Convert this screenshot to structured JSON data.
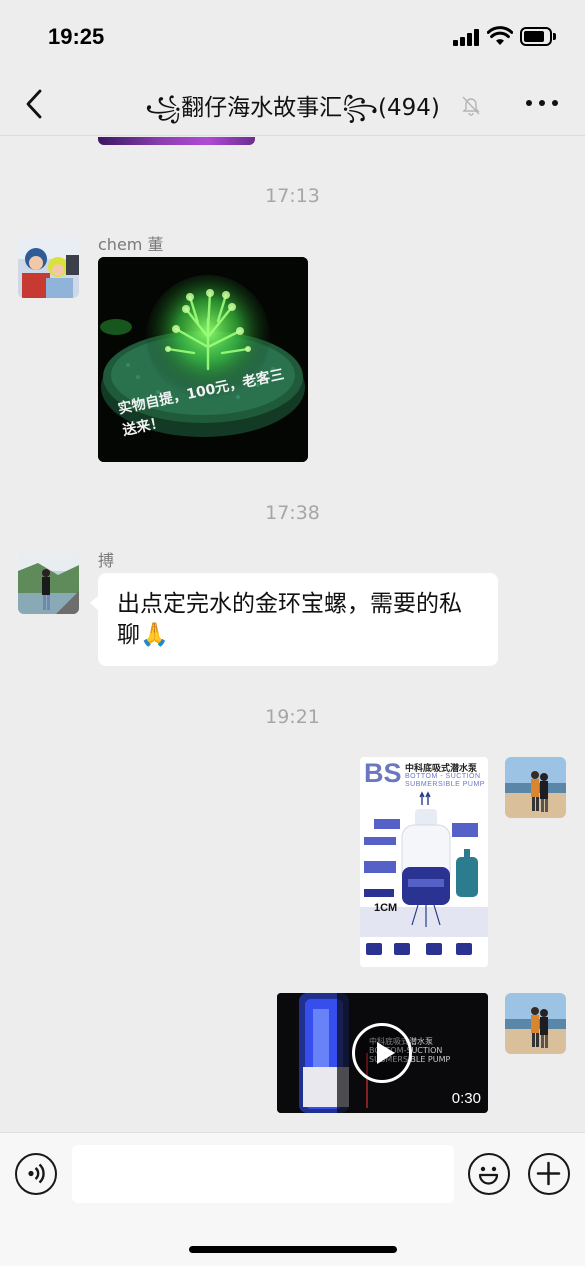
{
  "status_bar": {
    "time": "19:25"
  },
  "header": {
    "title": "🌬️翻仔海水故事汇🌬️(494)",
    "title_parts": {
      "deco_left": "꧁",
      "name": "翻仔海水故事汇",
      "deco_right": "꧂",
      "count": "(494)"
    },
    "icons": {
      "back": "chevron-left-icon",
      "mute": "bell-slash-icon",
      "more": "ellipsis-icon"
    }
  },
  "messages": {
    "time_1": "17:13",
    "msg_1": {
      "sender": "chem 董",
      "type": "image",
      "caption": "实物自提，100元，老客三送来！"
    },
    "time_2": "17:38",
    "msg_2": {
      "sender": "搏",
      "type": "text",
      "text": "出点定完水的金环宝螺，需要的私聊🙏"
    },
    "time_3": "19:21",
    "msg_3": {
      "type": "image",
      "poster": {
        "brand": "BS",
        "cn_title": "中科底吸式潜水泵",
        "en_title_1": "BOTTOM - SUCTION",
        "en_title_2": "SUBMERSIBLE PUMP",
        "spec": "1CM"
      }
    },
    "msg_4": {
      "type": "video",
      "duration": "0:30",
      "overlay_1": "中科底吸式潜水泵",
      "overlay_2": "BOTTOM-SUCTION",
      "overlay_3": "SUBMERSIBLE PUMP"
    }
  },
  "input_bar": {
    "placeholder": "",
    "icons": {
      "voice": "voice-waves-icon",
      "emoji": "smiley-icon",
      "add": "plus-icon"
    }
  },
  "colors": {
    "background": "#ededed",
    "bubble": "#ffffff",
    "timestamp": "#a6a6a6",
    "poster_accent": "#6a78c0"
  }
}
